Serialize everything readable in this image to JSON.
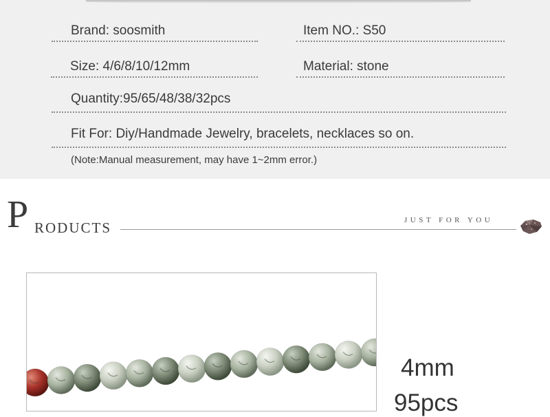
{
  "specs": {
    "brand": "Brand: soosmith",
    "item_no": "Item NO.: S50",
    "size": "Size: 4/6/8/10/12mm",
    "material": "Material: stone",
    "quantity": "Quantity:95/65/48/38/32pcs",
    "fit_for": "Fit For: Diy/Handmade Jewelry, bracelets, necklaces so on.",
    "note": "(Note:Manual measurement, may have 1~2mm error.)"
  },
  "products_header": {
    "initial": "P",
    "rest": "RODUCTS",
    "tagline": "JUST FOR YOU"
  },
  "product": {
    "size_label": "4mm",
    "qty_label": "95pcs"
  },
  "icons": [
    "gem-stone-icon"
  ],
  "colors": {
    "panel_bg": "#f0f0f0",
    "dot_line": "#8a8a8a",
    "text": "#3a3a3a"
  }
}
